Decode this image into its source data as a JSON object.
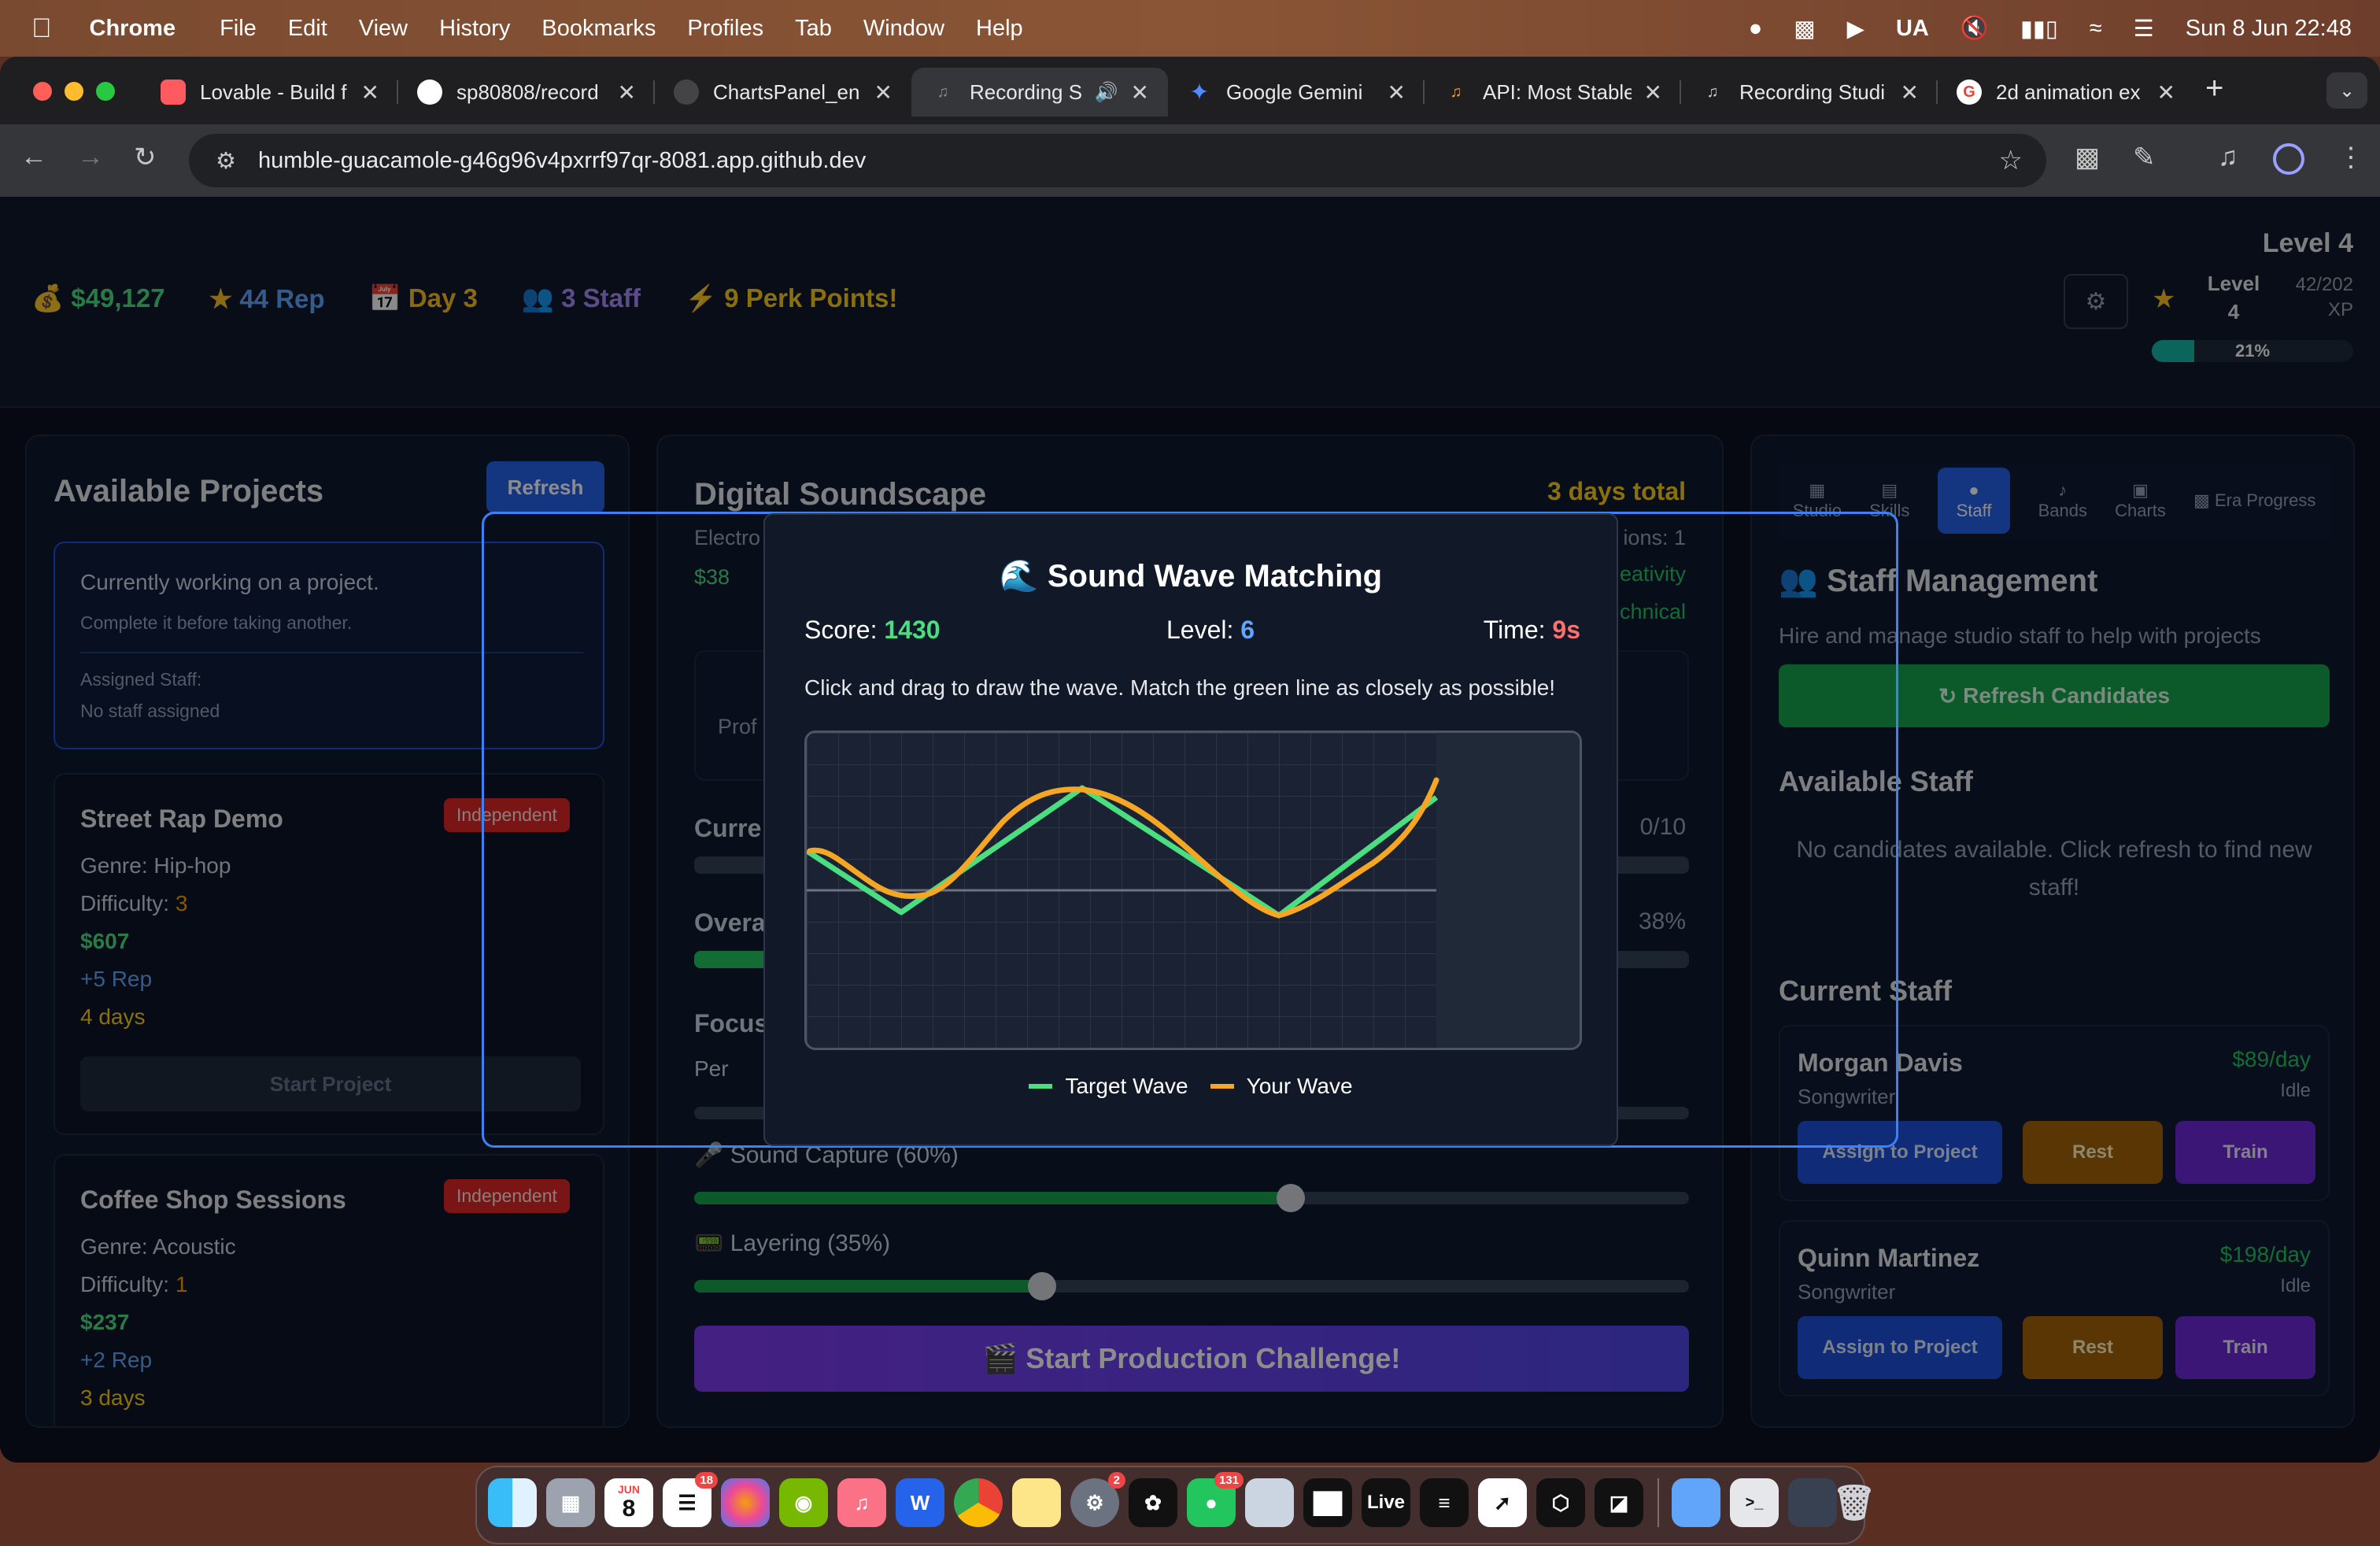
{
  "menubar": {
    "apple": "",
    "app_name": "Chrome",
    "items": [
      "File",
      "Edit",
      "View",
      "History",
      "Bookmarks",
      "Profiles",
      "Tab",
      "Window",
      "Help"
    ],
    "status": {
      "input": "UA",
      "datetime": "Sun 8 Jun  22:48"
    }
  },
  "tabs": [
    {
      "title": "Lovable - Build f",
      "icon": "lovable-icon",
      "color": "#ff5a5f"
    },
    {
      "title": "sp80808/record",
      "icon": "github-icon",
      "color": "#ffffff"
    },
    {
      "title": "ChartsPanel_en",
      "icon": "github-icon",
      "color": "#444444"
    },
    {
      "title": "Recording St",
      "icon": "music-icon",
      "color": "#777777"
    },
    {
      "title": "Google Gemini",
      "icon": "gemini-icon",
      "color": "#4f8cff"
    },
    {
      "title": "API: Most Stable",
      "icon": "music-icon",
      "color": "#e8a040"
    },
    {
      "title": "Recording Studi",
      "icon": "music-icon",
      "color": "#cccccc"
    },
    {
      "title": "2d animation ex",
      "icon": "google-icon",
      "color": "#ea4335"
    }
  ],
  "url": "humble-guacamole-g46g96v4pxrrf97qr-8081.app.github.dev",
  "stats": {
    "money": "$49,127",
    "rep": "44 Rep",
    "day": "Day 3",
    "staff": "3 Staff",
    "perks": "9 Perk Points!",
    "level_title": "Level 4",
    "level_label": "Level",
    "level_num": "4",
    "xp": "42/202",
    "xp_unit": "XP",
    "xp_pct": "21%",
    "xp_fraction": 0.21
  },
  "projects_panel": {
    "title": "Available Projects",
    "refresh": "Refresh",
    "working_title": "Currently working on a project.",
    "working_sub": "Complete it before taking another.",
    "assigned_label": "Assigned Staff:",
    "assigned_value": "No staff assigned",
    "projects": [
      {
        "name": "Street Rap Demo",
        "badge": "Independent",
        "genre": "Genre: Hip-hop",
        "difficulty_label": "Difficulty: ",
        "difficulty": "3",
        "pay": "$607",
        "rep": "+5 Rep",
        "days": "4 days",
        "start": "Start Project"
      },
      {
        "name": "Coffee Shop Sessions",
        "badge": "Independent",
        "genre": "Genre: Acoustic",
        "difficulty_label": "Difficulty: ",
        "difficulty": "1",
        "pay": "$237",
        "rep": "+2 Rep",
        "days": "3 days"
      }
    ]
  },
  "project_panel": {
    "title": "Digital Soundscape",
    "total": "3 days total",
    "sub_left": "Electro",
    "sub_right": "ions: 1",
    "money_partial": "$38",
    "creativity_partial": "eativity",
    "technical_partial": "chnical",
    "card_partial": "Prof",
    "current_label": "Curre",
    "current_value": "0/10",
    "overall_label": "Overa",
    "overall_value": "38%",
    "overall_fraction": 0.38,
    "focus_label": "Focus",
    "perf_partial": "Per",
    "sliders": [
      {
        "label": "Sound Capture (60%)",
        "value": 0.6
      },
      {
        "label": "Layering (35%)",
        "value": 0.35
      }
    ],
    "challenge_button": "Start Production Challenge!"
  },
  "staff_panel": {
    "tabs": [
      "Studio",
      "Skills",
      "Staff",
      "Bands",
      "Charts",
      "Era Progress"
    ],
    "active_tab": "Staff",
    "title": "Staff Management",
    "subtitle": "Hire and manage studio staff to help with projects",
    "refresh_button": "Refresh Candidates",
    "available_title": "Available Staff",
    "empty": "No candidates available. Click refresh to find new staff!",
    "current_title": "Current Staff",
    "staff": [
      {
        "name": "Morgan Davis",
        "role": "Songwriter",
        "rate": "$89/day",
        "status": "Idle"
      },
      {
        "name": "Quinn Martinez",
        "role": "Songwriter",
        "rate": "$198/day",
        "status": "Idle"
      }
    ],
    "assign": "Assign to Project",
    "rest": "Rest",
    "train": "Train"
  },
  "modal": {
    "title": "Sound Wave Matching",
    "score_label": "Score: ",
    "score": "1430",
    "level_label": "Level: ",
    "level": "6",
    "time_label": "Time: ",
    "time": "9s",
    "instructions": "Click and drag to draw the wave. Match the green line as closely as possible!",
    "legend_target": "Target Wave",
    "legend_user": "Your Wave",
    "colors": {
      "target": "#4ade80",
      "user": "#f5a623",
      "score": "#4ade80",
      "level": "#60a5fa",
      "time": "#f87171"
    }
  },
  "dock": {
    "apps": [
      "Finder",
      "Launchpad",
      "Calendar",
      "Reminders",
      "Photos",
      "Nvidia",
      "Music",
      "Word",
      "Chrome",
      "Notes",
      "Settings",
      "ChatGPT",
      "Messages",
      "Preview",
      "Piano",
      "Live",
      "Warp",
      "Cursor",
      "Unity",
      "Box",
      "Folder",
      "Terminal",
      "Screen",
      "Trash"
    ],
    "calendar_month": "JUN",
    "calendar_day": "8",
    "badges": {
      "reminders": "18",
      "settings": "2",
      "messages": "131"
    },
    "live_label": "Live"
  }
}
